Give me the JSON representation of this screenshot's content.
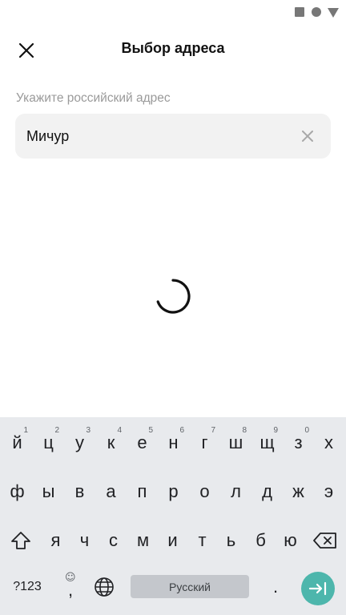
{
  "status_bar": {
    "icons": [
      "square-icon",
      "circle-icon",
      "triangle-icon"
    ]
  },
  "header": {
    "title": "Выбор адреса",
    "close_icon": "close-icon"
  },
  "address": {
    "label": "Укажите российский адрес",
    "value": "Мичур",
    "clear_icon": "clear-icon"
  },
  "loading": {
    "indicator": "spinner-icon"
  },
  "keyboard": {
    "row1": [
      {
        "key": "й",
        "hint": "1"
      },
      {
        "key": "ц",
        "hint": "2"
      },
      {
        "key": "у",
        "hint": "3"
      },
      {
        "key": "к",
        "hint": "4"
      },
      {
        "key": "е",
        "hint": "5"
      },
      {
        "key": "н",
        "hint": "6"
      },
      {
        "key": "г",
        "hint": "7"
      },
      {
        "key": "ш",
        "hint": "8"
      },
      {
        "key": "щ",
        "hint": "9"
      },
      {
        "key": "з",
        "hint": "0"
      },
      {
        "key": "х",
        "hint": ""
      }
    ],
    "row2": [
      "ф",
      "ы",
      "в",
      "а",
      "п",
      "р",
      "о",
      "л",
      "д",
      "ж",
      "э"
    ],
    "row3": [
      "я",
      "ч",
      "с",
      "м",
      "и",
      "т",
      "ь",
      "б",
      "ю"
    ],
    "symbols_label": "?123",
    "comma_label": ",",
    "emoji_hint": "☺",
    "space_label": "Русский",
    "period_label": ".",
    "accent_color": "#4db6ac"
  }
}
